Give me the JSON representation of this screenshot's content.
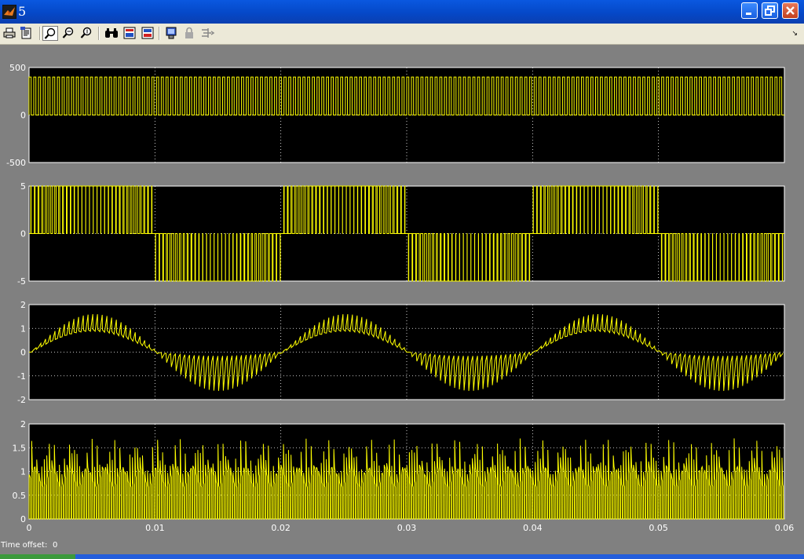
{
  "window": {
    "title": "5",
    "icon": "matlab-icon"
  },
  "window_controls": {
    "minimize": "minimize-icon",
    "maximize": "maximize-icon",
    "close": "close-icon"
  },
  "toolbar": {
    "items": [
      "print-icon",
      "print-preview-icon",
      "zoom-icon",
      "zoom-x-icon",
      "zoom-y-icon",
      "autoscale-binoculars-icon",
      "save-axes-icon",
      "restore-axes-icon",
      "parameters-icon",
      "lock-icon",
      "signal-selection-icon"
    ],
    "overflow": "chevron-icon"
  },
  "status": {
    "label": "Time offset:",
    "value": "0"
  },
  "colors": {
    "trace": "#FFFF00",
    "axes_bg": "#000000",
    "window_bg": "#808080",
    "grid": "#FFFFFF"
  },
  "chart_data": [
    {
      "type": "line",
      "title": "",
      "xlim": [
        0,
        0.06
      ],
      "ylim": [
        -500,
        500
      ],
      "yticks": [
        "500",
        "0",
        "-500"
      ],
      "xticks": [
        "0",
        "0.01",
        "0.02",
        "0.03",
        "0.04",
        "0.05",
        "0.06"
      ],
      "xtick_labels_shown": false,
      "series": [
        {
          "signal": "pwm-square",
          "high": 400,
          "low": 0,
          "pulses": 160,
          "duty": 0.55
        }
      ]
    },
    {
      "type": "line",
      "title": "",
      "xlim": [
        0,
        0.06
      ],
      "ylim": [
        -5,
        5
      ],
      "yticks": [
        "5",
        "0",
        "-5"
      ],
      "xticks": [
        "0",
        "0.01",
        "0.02",
        "0.03",
        "0.04",
        "0.05",
        "0.06"
      ],
      "xtick_labels_shown": false,
      "series": [
        {
          "signal": "bipolar-spwm",
          "amplitude": 5,
          "carrier_pulses": 200,
          "fundamental_hz": 50
        }
      ]
    },
    {
      "type": "line",
      "title": "",
      "xlim": [
        0,
        0.06
      ],
      "ylim": [
        -2,
        2
      ],
      "yticks": [
        "2",
        "1",
        "0",
        "-1",
        "-2"
      ],
      "xticks": [
        "0",
        "0.01",
        "0.02",
        "0.03",
        "0.04",
        "0.05",
        "0.06"
      ],
      "xtick_labels_shown": false,
      "series": [
        {
          "signal": "rippled-sine",
          "peak": 1.6,
          "fundamental_hz": 50,
          "ripple_pulses": 160
        }
      ]
    },
    {
      "type": "line",
      "title": "",
      "xlim": [
        0,
        0.06
      ],
      "ylim": [
        0,
        2
      ],
      "yticks": [
        "2",
        "1.5",
        "1",
        "0.5",
        "0"
      ],
      "xticks": [
        "0",
        "0.01",
        "0.02",
        "0.03",
        "0.04",
        "0.05",
        "0.06"
      ],
      "xtick_labels_shown": true,
      "series": [
        {
          "signal": "rectified-pulses",
          "peak": 1.7,
          "pulses": 300
        }
      ]
    }
  ]
}
